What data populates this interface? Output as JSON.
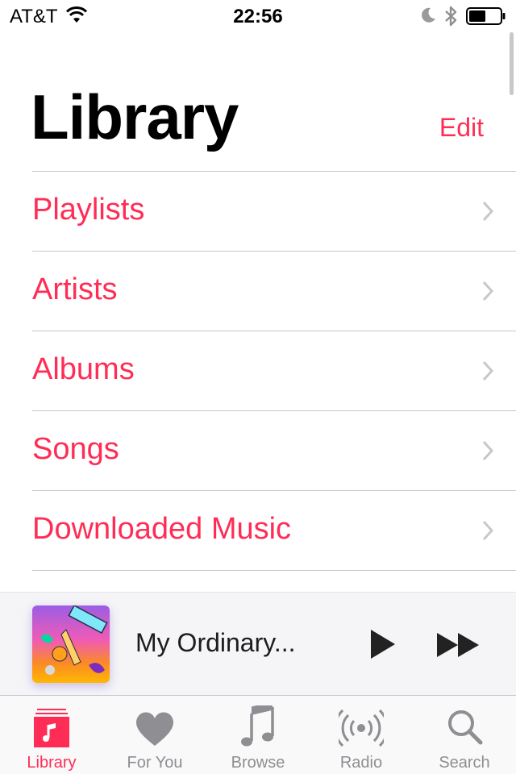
{
  "status_bar": {
    "carrier": "AT&T",
    "time": "22:56",
    "icons": [
      "wifi-icon",
      "moon-icon",
      "bluetooth-icon",
      "battery-icon"
    ]
  },
  "header": {
    "title": "Library",
    "edit_label": "Edit"
  },
  "library_items": [
    {
      "label": "Playlists"
    },
    {
      "label": "Artists"
    },
    {
      "label": "Albums"
    },
    {
      "label": "Songs"
    },
    {
      "label": "Downloaded Music"
    }
  ],
  "now_playing": {
    "title": "My Ordinary...",
    "play_icon": "play-icon",
    "forward_icon": "fast-forward-icon"
  },
  "tabs": [
    {
      "label": "Library",
      "icon": "library-icon",
      "active": true
    },
    {
      "label": "For You",
      "icon": "heart-icon",
      "active": false
    },
    {
      "label": "Browse",
      "icon": "music-note-icon",
      "active": false
    },
    {
      "label": "Radio",
      "icon": "radio-icon",
      "active": false
    },
    {
      "label": "Search",
      "icon": "search-icon",
      "active": false
    }
  ],
  "colors": {
    "accent": "#ff2d55",
    "inactive": "#8e8e93",
    "divider": "#c8c7cc"
  }
}
